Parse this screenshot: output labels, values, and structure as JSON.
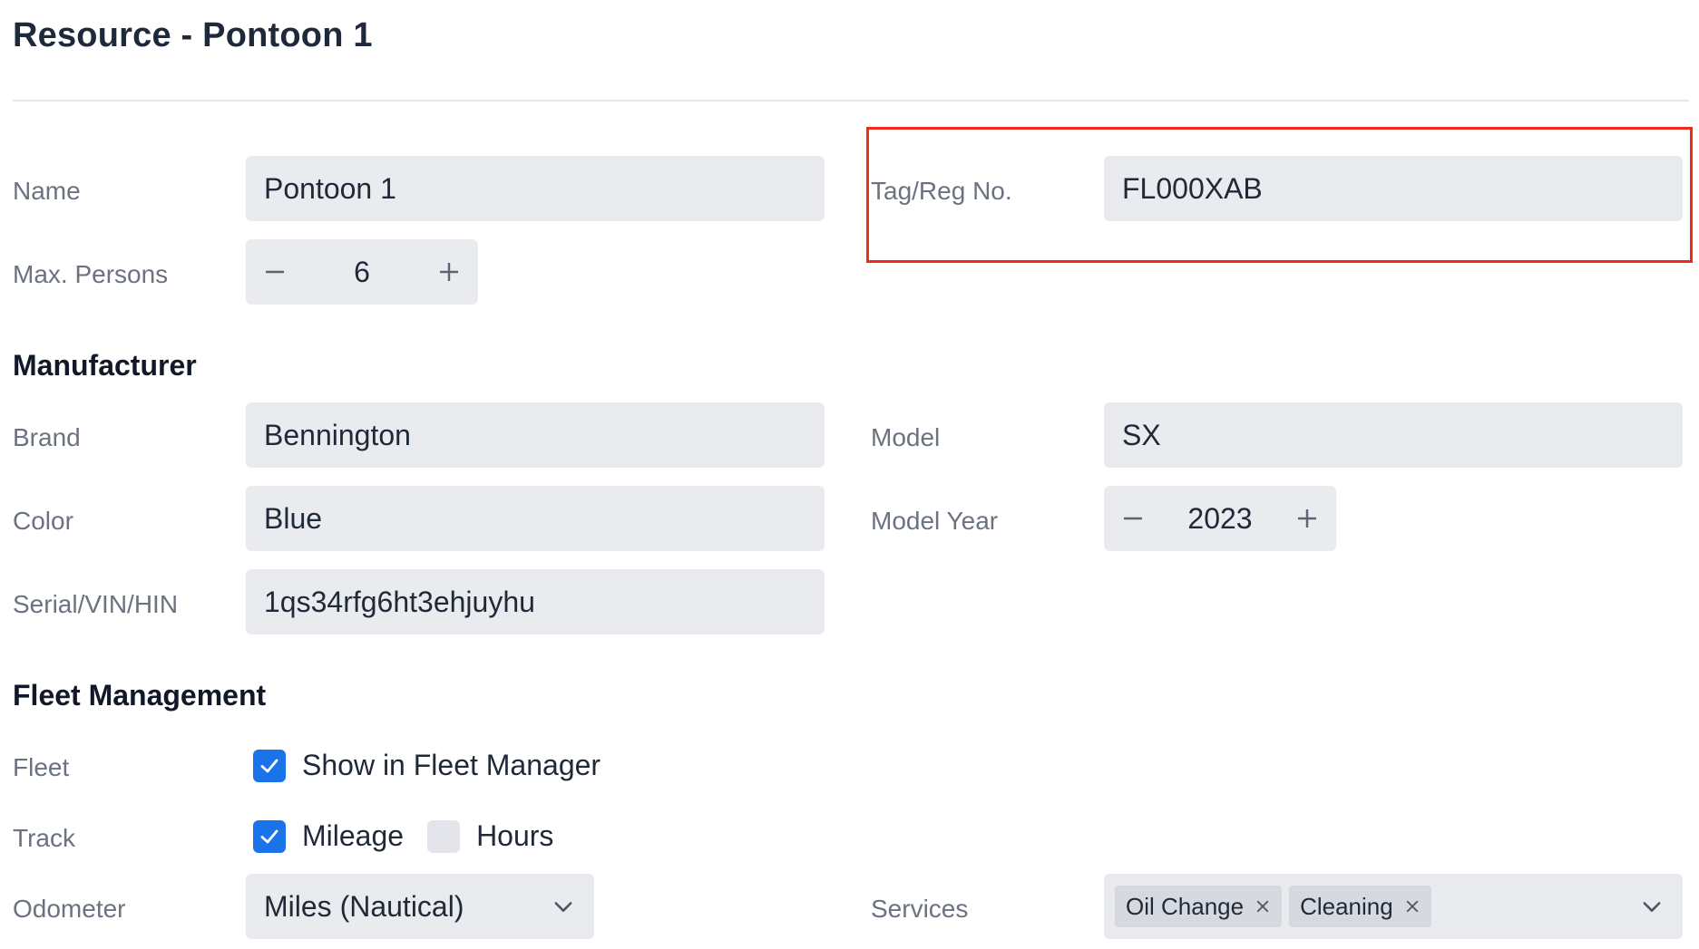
{
  "page": {
    "title": "Resource - Pontoon 1"
  },
  "basic": {
    "name_label": "Name",
    "name_value": "Pontoon 1",
    "tag_label": "Tag/Reg No.",
    "tag_value": "FL000XAB",
    "max_persons_label": "Max. Persons",
    "max_persons_value": "6"
  },
  "manufacturer": {
    "heading": "Manufacturer",
    "brand_label": "Brand",
    "brand_value": "Bennington",
    "model_label": "Model",
    "model_value": "SX",
    "color_label": "Color",
    "color_value": "Blue",
    "model_year_label": "Model Year",
    "model_year_value": "2023",
    "serial_label": "Serial/VIN/HIN",
    "serial_value": "1qs34rfg6ht3ehjuyhu"
  },
  "fleet": {
    "heading": "Fleet Management",
    "fleet_label": "Fleet",
    "show_in_fleet_label": "Show in Fleet Manager",
    "show_in_fleet_checked": true,
    "track_label": "Track",
    "mileage_label": "Mileage",
    "mileage_checked": true,
    "hours_label": "Hours",
    "hours_checked": false,
    "odometer_label": "Odometer",
    "odometer_value": "Miles (Nautical)",
    "services_label": "Services",
    "services": [
      "Oil Change",
      "Cleaning"
    ]
  },
  "colors": {
    "accent": "#1a73e8",
    "highlight": "#ef2b1e",
    "field_bg": "#e9ebef"
  }
}
